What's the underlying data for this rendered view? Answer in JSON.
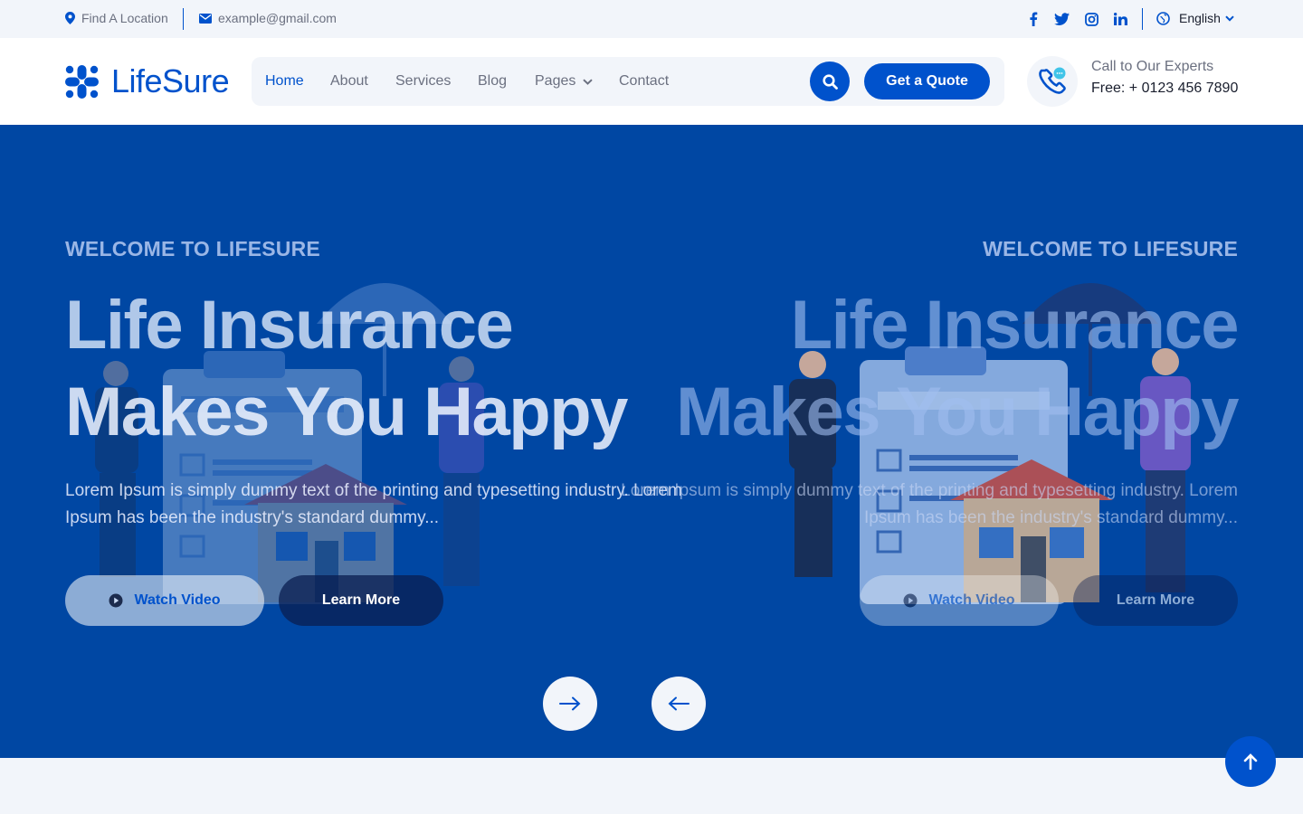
{
  "topbar": {
    "location": "Find A Location",
    "email": "example@gmail.com",
    "language": "English",
    "social_icons": [
      "facebook-icon",
      "twitter-icon",
      "instagram-icon",
      "linkedin-icon"
    ]
  },
  "header": {
    "logo_text": "LifeSure",
    "nav": [
      {
        "label": "Home",
        "active": true
      },
      {
        "label": "About"
      },
      {
        "label": "Services"
      },
      {
        "label": "Blog"
      },
      {
        "label": "Pages"
      },
      {
        "label": "Contact"
      }
    ],
    "quote_button": "Get a Quote",
    "call_label": "Call to Our Experts",
    "call_phone": "Free: + 0123 456 7890"
  },
  "hero": {
    "tagline": "WELCOME TO LIFESURE",
    "title_line1": "Life Insurance",
    "title_line2": "Makes You Happy",
    "paragraph": "Lorem Ipsum is simply dummy text of the printing and typesetting industry. Lorem Ipsum has been the industry's standard dummy...",
    "watch_button": "Watch Video",
    "learn_button": "Learn More"
  },
  "colors": {
    "accent": "#0052cc",
    "hero_bg": "#0047a3",
    "light_bg": "#f2f5fa"
  }
}
